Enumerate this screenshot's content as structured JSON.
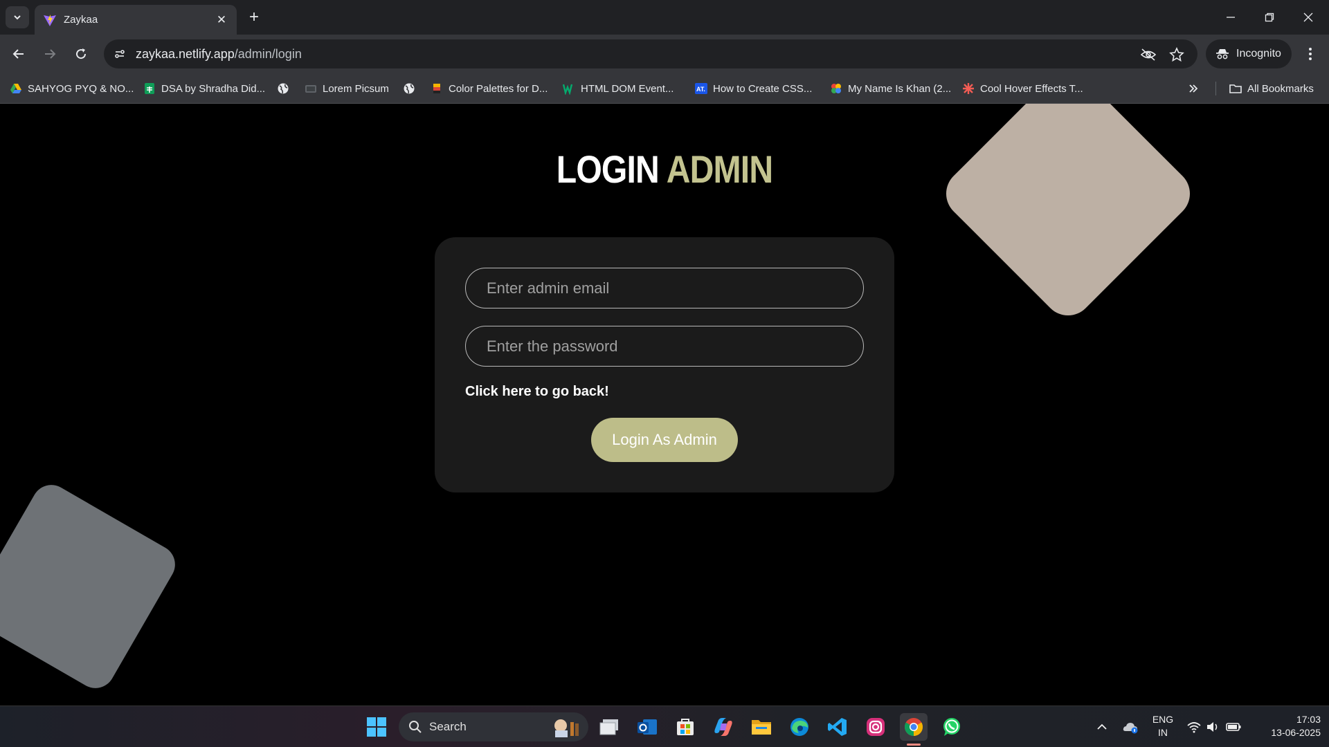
{
  "browser": {
    "tab_title": "Zaykaa",
    "url_host": "zaykaa.netlify.app",
    "url_path": "/admin/login",
    "incognito_label": "Incognito",
    "bookmarks": [
      {
        "label": "SAHYOG PYQ & NO...",
        "icon": "drive-icon"
      },
      {
        "label": "DSA by Shradha Did...",
        "icon": "sheets-icon"
      },
      {
        "label": "",
        "icon": "globe-icon"
      },
      {
        "label": "Lorem Picsum",
        "icon": "picsum-icon"
      },
      {
        "label": "",
        "icon": "globe-icon"
      },
      {
        "label": "Color Palettes for D...",
        "icon": "palette-icon"
      },
      {
        "label": "HTML DOM Event...",
        "icon": "w3schools-icon"
      },
      {
        "label": "How to Create CSS...",
        "icon": "aT-icon"
      },
      {
        "label": "My Name Is Khan (2...",
        "icon": "movie-icon"
      },
      {
        "label": "Cool Hover Effects T...",
        "icon": "asterisk-icon"
      }
    ],
    "all_bookmarks_label": "All Bookmarks"
  },
  "page": {
    "heading_part1": "LOGIN",
    "heading_part2": "ADMIN",
    "email_placeholder": "Enter admin email",
    "password_placeholder": "Enter the password",
    "back_link": "Click here to go back!",
    "login_button": "Login As Admin"
  },
  "taskbar": {
    "search_label": "Search",
    "lang_line1": "ENG",
    "lang_line2": "IN",
    "time": "17:03",
    "date": "13-06-2025"
  },
  "colors": {
    "accent": "#c3c38f",
    "button": "#bdbd89",
    "card": "#1b1b1b",
    "deco_top": "#bdb0a4",
    "deco_bottom": "#6e7276"
  }
}
